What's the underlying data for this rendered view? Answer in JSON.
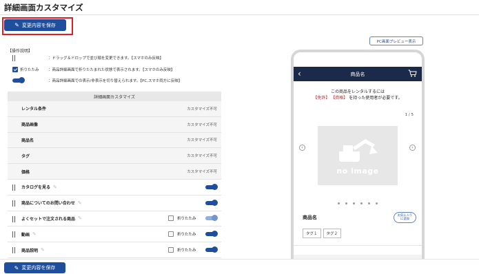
{
  "page": {
    "title": "詳細画面カスタマイズ"
  },
  "actions": {
    "save_label": "変更内容を保存",
    "pc_preview_label": "PC画面プレビュー表示"
  },
  "legend": {
    "heading": "【操作説明】",
    "rows": [
      {
        "icon": "drag-handle-icon",
        "label": "",
        "text": "：ドラッグ＆ドロップで並び順を変更できます。【スマホのみ反映】"
      },
      {
        "icon": "checkbox-icon",
        "label": "折りたたみ",
        "text": "：商品詳細画面で折りたたまれた状態で表示されます。【スマホのみ反映】"
      },
      {
        "icon": "toggle-icon",
        "label": "",
        "text": "：商品詳細画面での表示/非表示を切り替えられます。【PC,スマホ両方に反映】"
      }
    ]
  },
  "table": {
    "header": "詳細画面カスタマイズ",
    "fold_label": "折りたたみ",
    "rows": [
      {
        "name": "レンタル条件",
        "fixed": true,
        "status": "カスタマイズ不可"
      },
      {
        "name": "商品画像",
        "fixed": true,
        "status": "カスタマイズ不可"
      },
      {
        "name": "商品名",
        "fixed": true,
        "status": "カスタマイズ不可"
      },
      {
        "name": "タグ",
        "fixed": true,
        "status": "カスタマイズ不可"
      },
      {
        "name": "価格",
        "fixed": true,
        "status": "カスタマイズ不可"
      },
      {
        "name": "カタログを見る",
        "fixed": false,
        "has_fold": false,
        "visible": true
      },
      {
        "name": "商品についてのお問い合わせ",
        "fixed": false,
        "has_fold": false,
        "visible": true
      },
      {
        "name": "よくセットで注文される商品",
        "fixed": false,
        "has_fold": true,
        "folded": false,
        "visible": true,
        "toggle_style": "light"
      },
      {
        "name": "動画",
        "fixed": false,
        "has_fold": true,
        "folded": false,
        "visible": true
      },
      {
        "name": "商品説明",
        "fixed": false,
        "has_fold": true,
        "folded": false,
        "visible": true
      }
    ]
  },
  "preview": {
    "header_title": "商品名",
    "notice_line1": "この商品をレンタルするには",
    "notice_req1": "【免許】",
    "notice_req2": "【資格】",
    "notice_line2_suffix": "を持った使用者が必要です。",
    "pager": "1 / 5",
    "no_image_text": "no image",
    "product_name": "商品名",
    "fav_line1": "お気に入り",
    "fav_line2": "に追加",
    "tags": [
      "タグ１",
      "タグ２"
    ],
    "dot_count": 6
  },
  "colors": {
    "primary": "#1f4e9c",
    "highlight_border": "#e02020",
    "phone_header": "#1b2a4a",
    "required_red": "#d42020"
  }
}
